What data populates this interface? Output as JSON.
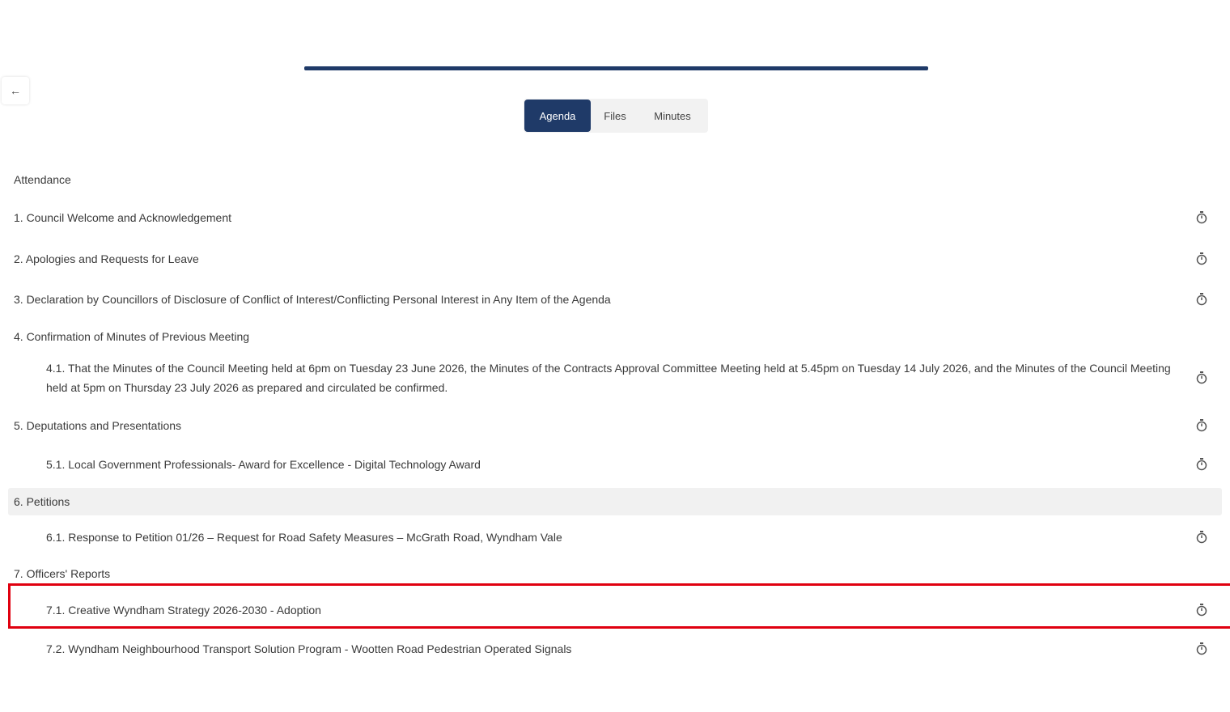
{
  "tabs": [
    "Agenda",
    "Files",
    "Minutes"
  ],
  "active_tab": "Agenda",
  "attendance_label": "Attendance",
  "agenda_items": [
    {
      "label": "1. Council Welcome and Acknowledgement"
    },
    {
      "label": "2. Apologies and Requests for Leave"
    },
    {
      "label": "3. Declaration by Councillors of Disclosure of Conflict of Interest/Conflicting Personal Interest in Any Item of the Agenda"
    },
    {
      "label": "4. Confirmation of Minutes of Previous Meeting"
    },
    {
      "label": "4.1. That the Minutes of the Council Meeting held at 6pm on Tuesday 23 June 2026, the Minutes of the Contracts Approval Committee Meeting held at 5.45pm on Tuesday 14 July 2026, and the Minutes of the Council Meeting held at 5pm on Thursday 23 July 2026 as prepared and circulated be confirmed."
    },
    {
      "label": "5. Deputations and Presentations"
    },
    {
      "label": "5.1. Local Government Professionals-  Award for Excellence - Digital Technology Award"
    },
    {
      "label": "6. Petitions"
    },
    {
      "label": "6.1. Response to Petition 01/26 – Request for Road Safety Measures – McGrath Road, Wyndham Vale"
    },
    {
      "label": "7. Officers' Reports"
    },
    {
      "label": "7.1. Creative Wyndham Strategy 2026-2030 - Adoption"
    },
    {
      "label": "7.2. Wyndham Neighbourhood Transport Solution Program - Wootten Road Pedestrian Operated Signals"
    }
  ],
  "icons": {
    "back": "arrow-left-icon",
    "item_action": "stopwatch-icon"
  },
  "colors": {
    "primary": "#1f3a68",
    "selection": "#e0000f",
    "hover_row": "#f1f1f1"
  }
}
